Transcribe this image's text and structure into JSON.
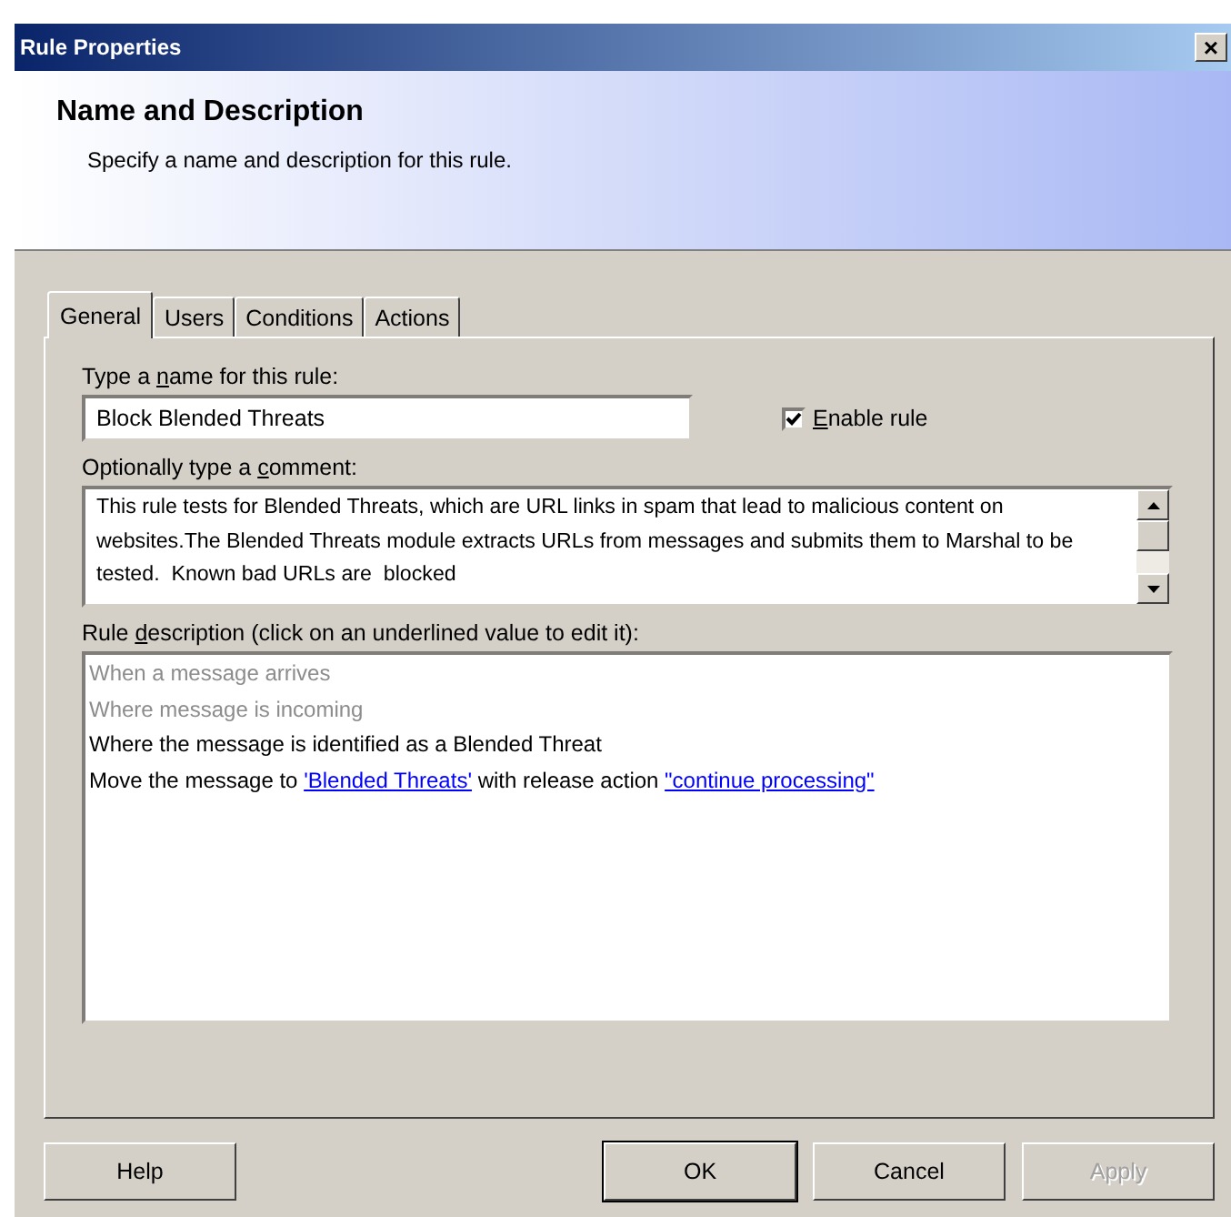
{
  "window": {
    "title": "Rule Properties",
    "close": "×"
  },
  "header": {
    "title": "Name and Description",
    "subtitle": "Specify a name and description for this rule."
  },
  "tabs": [
    {
      "label": "General",
      "selected": true
    },
    {
      "label": "Users",
      "selected": false
    },
    {
      "label": "Conditions",
      "selected": false
    },
    {
      "label": "Actions",
      "selected": false
    }
  ],
  "name_label": {
    "before": "Type a ",
    "key": "n",
    "after": "ame for this rule:"
  },
  "name_field": {
    "value": "Block Blended Threats"
  },
  "enable_rule": {
    "label": {
      "key": "E",
      "after": "nable rule"
    },
    "checked": true
  },
  "comment_label": {
    "before": "Optionally type a ",
    "key": "c",
    "after": "omment:"
  },
  "comment_field": {
    "value": "This rule tests for Blended Threats, which are URL links in spam that lead to malicious content on websites.The Blended Threats module extracts URLs from messages and submits them to Marshal to be tested.  Known bad URLs are  blocked"
  },
  "description_label": {
    "before": "Rule ",
    "key": "d",
    "after": "escription (click on an underlined value to edit it):"
  },
  "description_lines": [
    {
      "enabled": false,
      "parts": [
        {
          "kind": "plain",
          "text": "When a message arrives"
        }
      ]
    },
    {
      "enabled": false,
      "parts": [
        {
          "kind": "plain",
          "text": "Where message is incoming"
        }
      ]
    },
    {
      "enabled": true,
      "parts": [
        {
          "kind": "plain",
          "text": "Where the message is identified as a Blended Threat"
        }
      ]
    },
    {
      "enabled": true,
      "parts": [
        {
          "kind": "plain",
          "text": "Move the message to "
        },
        {
          "kind": "link",
          "text": "'Blended Threats'"
        },
        {
          "kind": "plain",
          "text": " with release action "
        },
        {
          "kind": "link",
          "text": "\"continue processing\""
        }
      ]
    }
  ],
  "buttons": [
    {
      "label": "Help",
      "default": false,
      "disabled": false
    },
    {
      "label": "OK",
      "default": true,
      "disabled": false
    },
    {
      "label": "Cancel",
      "default": false,
      "disabled": false
    },
    {
      "label": "Apply",
      "default": false,
      "disabled": true
    }
  ]
}
